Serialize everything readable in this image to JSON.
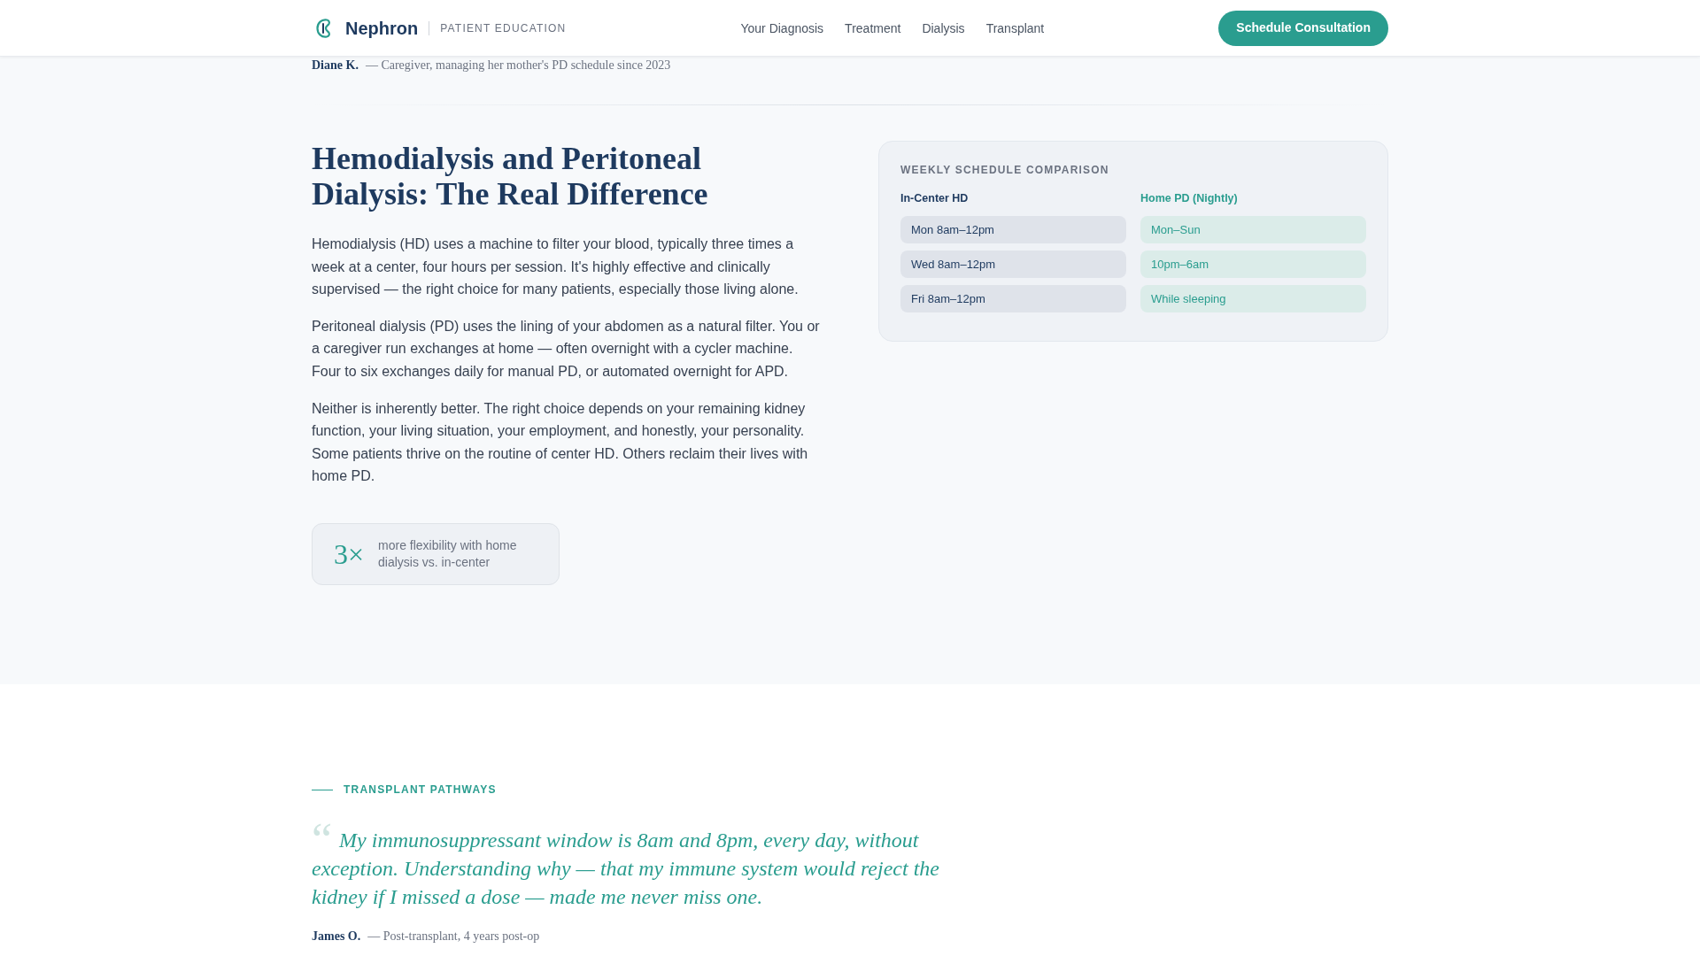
{
  "header": {
    "brand": "Nephron",
    "tagline": "PATIENT EDUCATION",
    "nav": [
      "Your Diagnosis",
      "Treatment",
      "Dialysis",
      "Transplant"
    ],
    "cta": "Schedule Consultation"
  },
  "previous_testimonial": {
    "author": "Diane K.",
    "detail": "— Caregiver, managing her mother's PD schedule since 2023"
  },
  "dialysis_section": {
    "heading": "Hemodialysis and Peritoneal Dialysis: The Real Difference",
    "paragraphs": [
      "Hemodialysis (HD) uses a machine to filter your blood, typically three times a week at a center, four hours per session. It's highly effective and clinically supervised — the right choice for many patients, especially those living alone.",
      "Peritoneal dialysis (PD) uses the lining of your abdomen as a natural filter. You or a caregiver run exchanges at home — often overnight with a cycler machine. Four to six exchanges daily for manual PD, or automated overnight for APD.",
      "Neither is inherently better. The right choice depends on your remaining kidney function, your living situation, your employment, and honestly, your personality. Some patients thrive on the routine of center HD. Others reclaim their lives with home PD."
    ],
    "stat": {
      "value": "3×",
      "text": "more flexibility with home dialysis vs. in-center"
    },
    "schedule_card": {
      "title": "WEEKLY SCHEDULE COMPARISON",
      "columns": [
        {
          "heading": "In-Center HD",
          "kind": "center",
          "slots": [
            "Mon 8am–12pm",
            "Wed 8am–12pm",
            "Fri 8am–12pm"
          ]
        },
        {
          "heading": "Home PD (Nightly)",
          "kind": "home",
          "slots": [
            "Mon–Sun",
            "10pm–6am",
            "While sleeping"
          ]
        }
      ]
    }
  },
  "transplant_section": {
    "eyebrow": "TRANSPLANT PATHWAYS",
    "quote_mark": "“",
    "quote": "My immunosuppressant window is 8am and 8pm, every day, without exception. Understanding why — that my immune system would reject the kidney if I missed a dose — made me never miss one.",
    "author": "James O.",
    "detail": "— Post-transplant, 4 years post-op"
  }
}
